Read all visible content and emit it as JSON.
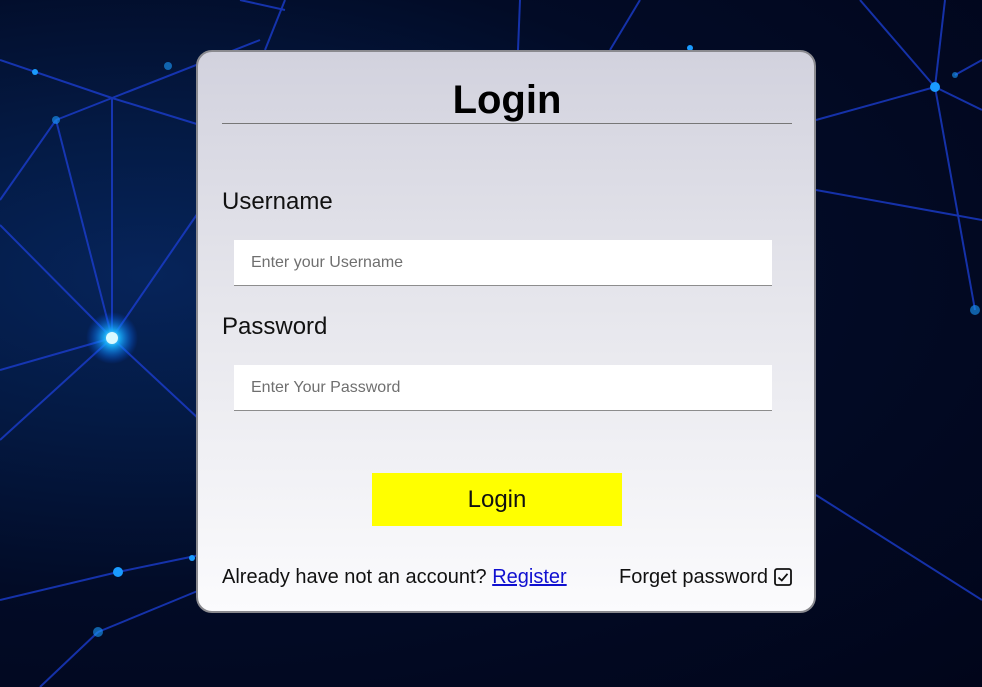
{
  "login_card": {
    "title": "Login",
    "username": {
      "label": "Username",
      "placeholder": "Enter your Username",
      "value": ""
    },
    "password": {
      "label": "Password",
      "placeholder": "Enter Your Password",
      "value": ""
    },
    "submit_label": "Login",
    "register_prompt": "Already have not an account?",
    "register_link": "Register",
    "forget_password": "Forget password"
  },
  "colors": {
    "button": "#ffff00",
    "link": "#1010d0",
    "background": "#020b26"
  },
  "icons": {
    "forget_password": "checkbox-checked-icon"
  }
}
